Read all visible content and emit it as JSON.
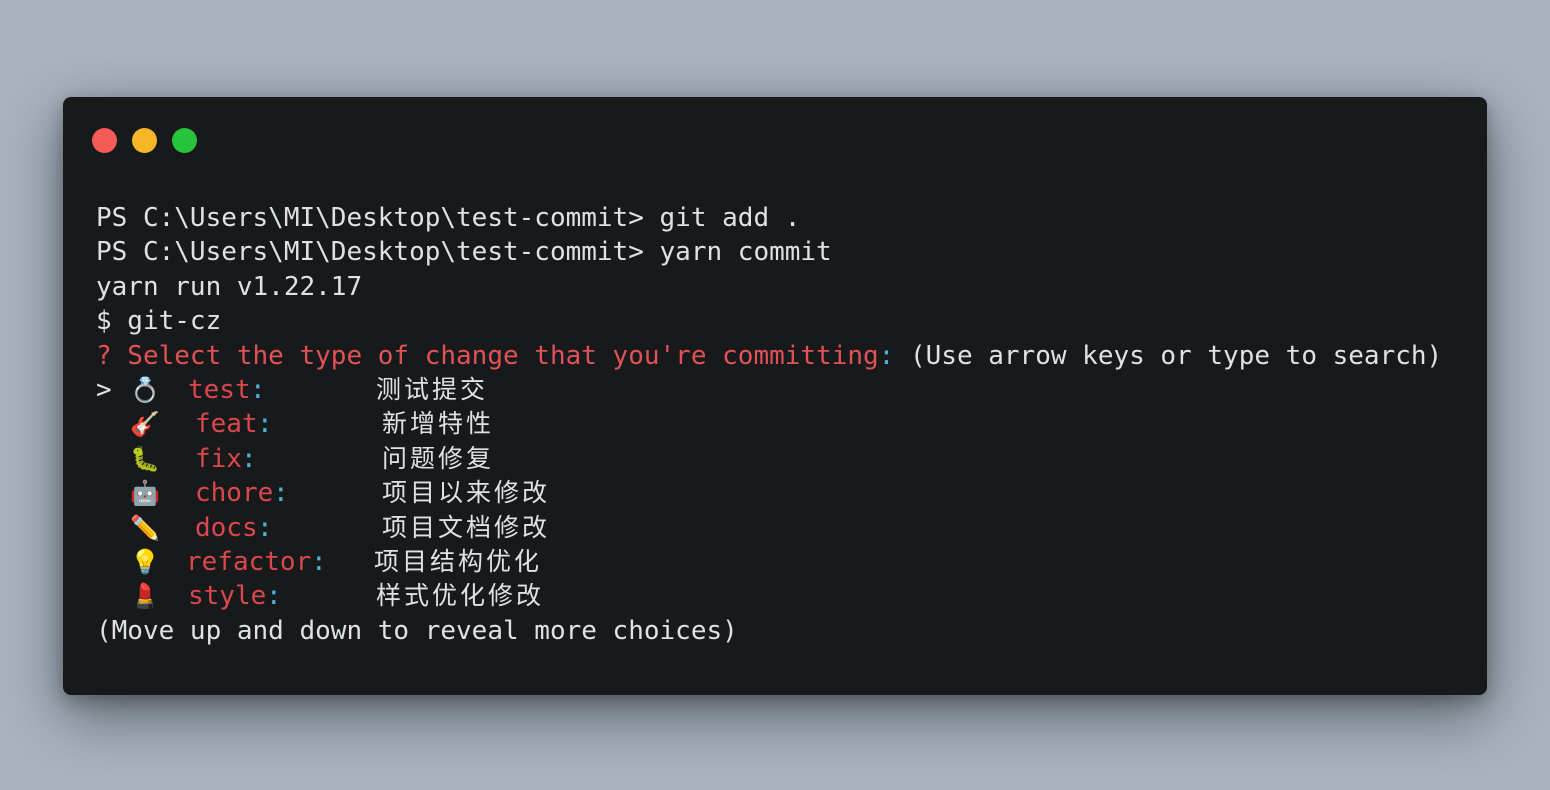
{
  "window": {
    "buttons": {
      "close_color": "#f45b57",
      "minimize_color": "#f6b726",
      "maximize_color": "#27c33d"
    }
  },
  "terminal": {
    "lines": [
      "PS C:\\Users\\MI\\Desktop\\test-commit> git add .",
      "PS C:\\Users\\MI\\Desktop\\test-commit> yarn commit",
      "yarn run v1.22.17",
      "$ git-cz"
    ],
    "question": {
      "text": "? Select the type of change that you're committing",
      "colon": ":",
      "hint": " (Use arrow keys or type to search)"
    },
    "pointer": ">",
    "choices": [
      {
        "icon": "ring-icon",
        "glyph": "💍",
        "type": "test",
        "desc": "测试提交"
      },
      {
        "icon": "guitar-icon",
        "glyph": "🎸",
        "type": "feat",
        "desc": "新增特性"
      },
      {
        "icon": "bug-icon",
        "glyph": "🐛",
        "type": "fix",
        "desc": "问题修复"
      },
      {
        "icon": "robot-icon",
        "glyph": "🤖",
        "type": "chore",
        "desc": "项目以来修改"
      },
      {
        "icon": "pencil-icon",
        "glyph": "✏️",
        "type": "docs",
        "desc": "项目文档修改"
      },
      {
        "icon": "lightbulb-icon",
        "glyph": "💡",
        "type": "refactor",
        "desc": "项目结构优化"
      },
      {
        "icon": "lipstick-icon",
        "glyph": "💄",
        "type": "style",
        "desc": "样式优化修改"
      }
    ],
    "footer": "(Move up and down to reveal more choices)"
  }
}
